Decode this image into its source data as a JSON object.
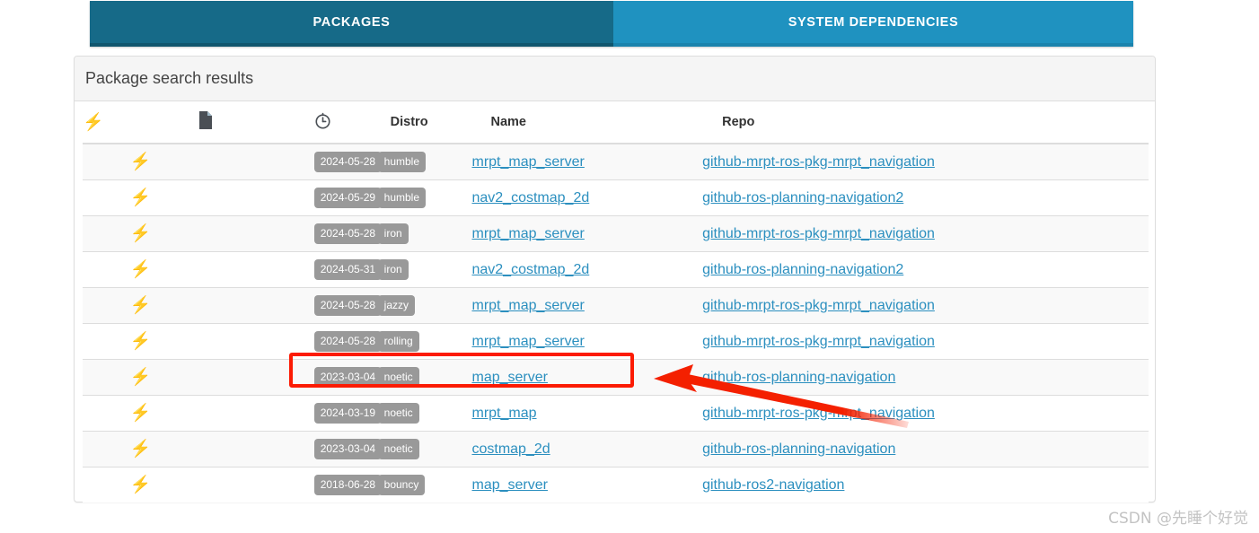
{
  "tabs": [
    {
      "label": "PACKAGES",
      "active": true,
      "color": "#166A88"
    },
    {
      "label": "SYSTEM DEPENDENCIES",
      "active": false,
      "color": "#1F92C0"
    }
  ],
  "panel": {
    "title": "Package search results"
  },
  "table": {
    "headers": {
      "lightning": "lightning-bolt-icon",
      "document": "document-icon",
      "clock": "clock-icon",
      "distro": "Distro",
      "name": "Name",
      "repo": "Repo"
    },
    "rows": [
      {
        "date": "2024-05-28",
        "distro": "humble",
        "name": "mrpt_map_server",
        "repo": "github-mrpt-ros-pkg-mrpt_navigation",
        "highlighted": false
      },
      {
        "date": "2024-05-29",
        "distro": "humble",
        "name": "nav2_costmap_2d",
        "repo": "github-ros-planning-navigation2",
        "highlighted": false
      },
      {
        "date": "2024-05-28",
        "distro": "iron",
        "name": "mrpt_map_server",
        "repo": "github-mrpt-ros-pkg-mrpt_navigation",
        "highlighted": false
      },
      {
        "date": "2024-05-31",
        "distro": "iron",
        "name": "nav2_costmap_2d",
        "repo": "github-ros-planning-navigation2",
        "highlighted": false
      },
      {
        "date": "2024-05-28",
        "distro": "jazzy",
        "name": "mrpt_map_server",
        "repo": "github-mrpt-ros-pkg-mrpt_navigation",
        "highlighted": false
      },
      {
        "date": "2024-05-28",
        "distro": "rolling",
        "name": "mrpt_map_server",
        "repo": "github-mrpt-ros-pkg-mrpt_navigation",
        "highlighted": false
      },
      {
        "date": "2023-03-04",
        "distro": "noetic",
        "name": "map_server",
        "repo": "github-ros-planning-navigation",
        "highlighted": true
      },
      {
        "date": "2024-03-19",
        "distro": "noetic",
        "name": "mrpt_map",
        "repo": "github-mrpt-ros-pkg-mrpt_navigation",
        "highlighted": false
      },
      {
        "date": "2023-03-04",
        "distro": "noetic",
        "name": "costmap_2d",
        "repo": "github-ros-planning-navigation",
        "highlighted": false
      },
      {
        "date": "2018-06-28",
        "distro": "bouncy",
        "name": "map_server",
        "repo": "github-ros2-navigation",
        "highlighted": false
      }
    ]
  },
  "annotations": {
    "highlight_color": "#fc1b04",
    "arrow_color": "#f42000",
    "arrow_name": "red-pointer-arrow",
    "highlight_name": "red-highlight-box"
  },
  "watermark": {
    "text": "CSDN @先睡个好觉"
  }
}
